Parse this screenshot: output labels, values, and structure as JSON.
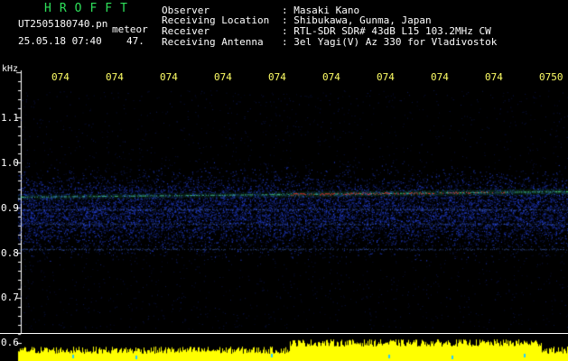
{
  "header": {
    "app_title": "HROFFT",
    "filename": "UT2505180740.pn",
    "meteor_label": "meteor",
    "datetime": "25.05.18 07:40",
    "count": "47."
  },
  "info": [
    {
      "label": "Observer",
      "value": ": Masaki Kano"
    },
    {
      "label": "Receiving Location",
      "value": ": Shibukawa, Gunma, Japan"
    },
    {
      "label": "Receiver",
      "value": ": RTL-SDR SDR# 43dB L15 103.2MHz CW"
    },
    {
      "label": "Receiving Antenna",
      "value": ": 3el Yagi(V) Az 330 for Vladivostok"
    }
  ],
  "axis": {
    "unit": "kHz",
    "time_ticks": [
      "074",
      "074",
      "074",
      "074",
      "074",
      "074",
      "074",
      "074",
      "074",
      "0750"
    ],
    "y_ticks": [
      "1.1",
      "1.0",
      "0.9",
      "0.8",
      "0.7",
      "0.6"
    ]
  },
  "colors": {
    "background": "#000000",
    "title_green": "#2ee05a",
    "tick_yellow": "#ffff66",
    "text_white": "#ffffff",
    "signal_blue": "#1e50ff",
    "signal_red": "#ff2a2a",
    "amplitude_yellow": "#ffff00"
  }
}
